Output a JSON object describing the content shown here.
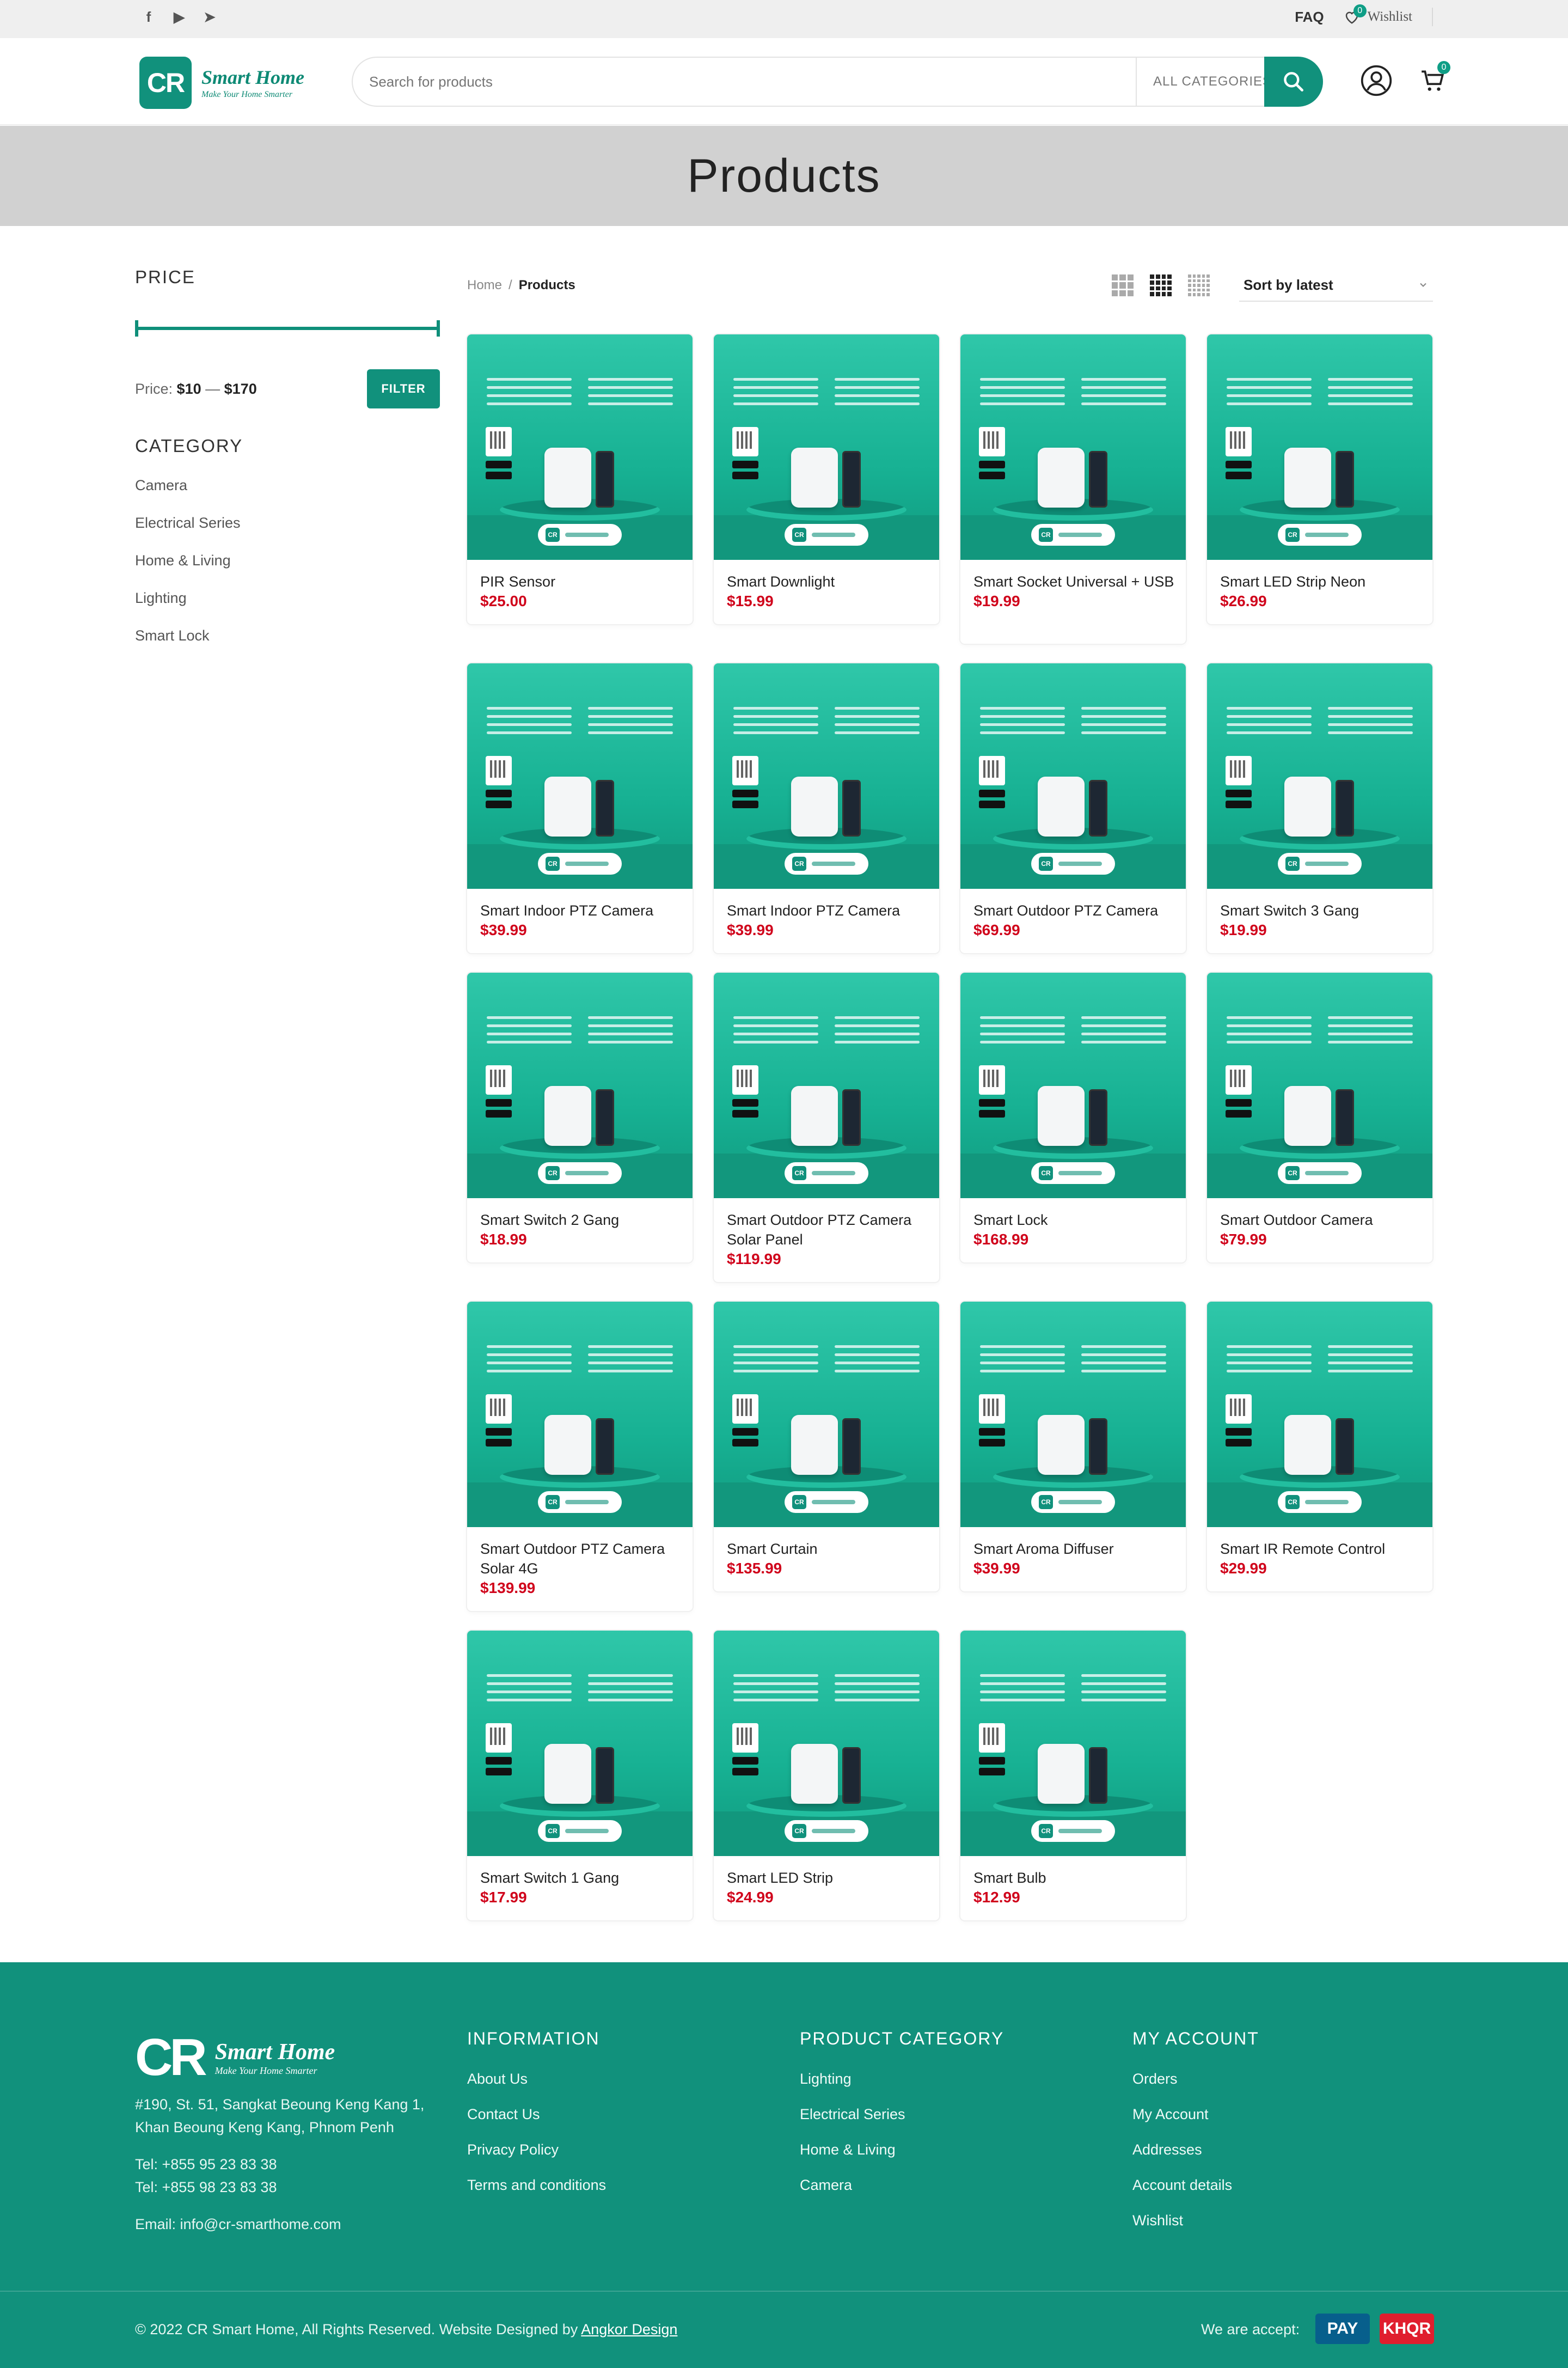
{
  "topbar": {
    "social": [
      "f",
      "▶",
      "➤"
    ],
    "faq": "FAQ",
    "wishlist": "Wishlist",
    "wishlist_count": "0"
  },
  "header": {
    "logo_mark": "CR",
    "logo_title": "Smart Home",
    "logo_tagline": "Make Your Home Smarter",
    "search_placeholder": "Search for products",
    "category_select": "ALL CATEGORIES",
    "cart_count": "0"
  },
  "page_title": "Products",
  "sidebar": {
    "price_heading": "PRICE",
    "price_label": "Price:",
    "price_min": "$10",
    "price_sep": "—",
    "price_max": "$170",
    "filter_label": "FILTER",
    "category_heading": "CATEGORY",
    "categories": [
      "Camera",
      "Electrical Series",
      "Home & Living",
      "Lighting",
      "Smart Lock"
    ]
  },
  "toolbar": {
    "breadcrumb_home": "Home",
    "breadcrumb_sep": "/",
    "breadcrumb_current": "Products",
    "sort_label": "Sort by latest"
  },
  "products": [
    {
      "name": "PIR Sensor",
      "price": "$25.00"
    },
    {
      "name": "Smart Downlight",
      "price": "$15.99"
    },
    {
      "name": "Smart Socket Universal + USB",
      "price": "$19.99"
    },
    {
      "name": "Smart LED Strip Neon",
      "price": "$26.99"
    },
    {
      "name": "Smart Indoor PTZ Camera",
      "price": "$39.99"
    },
    {
      "name": "Smart Indoor PTZ Camera",
      "price": "$39.99"
    },
    {
      "name": "Smart Outdoor PTZ Camera",
      "price": "$69.99"
    },
    {
      "name": "Smart Switch 3 Gang",
      "price": "$19.99"
    },
    {
      "name": "Smart Switch 2 Gang",
      "price": "$18.99"
    },
    {
      "name": "Smart Outdoor PTZ Camera Solar Panel",
      "price": "$119.99"
    },
    {
      "name": "Smart Lock",
      "price": "$168.99"
    },
    {
      "name": "Smart Outdoor Camera",
      "price": "$79.99"
    },
    {
      "name": "Smart Outdoor PTZ Camera Solar 4G",
      "price": "$139.99"
    },
    {
      "name": "Smart Curtain",
      "price": "$135.99"
    },
    {
      "name": "Smart Aroma Diffuser",
      "price": "$39.99"
    },
    {
      "name": "Smart IR Remote Control",
      "price": "$29.99"
    },
    {
      "name": "Smart Switch 1 Gang",
      "price": "$17.99"
    },
    {
      "name": "Smart LED Strip",
      "price": "$24.99"
    },
    {
      "name": "Smart Bulb",
      "price": "$12.99"
    }
  ],
  "footer": {
    "logo_mark": "CR",
    "logo_title": "Smart Home",
    "logo_tagline": "Make Your Home Smarter",
    "address": "#190, St. 51, Sangkat Beoung Keng Kang 1, Khan Beoung Keng Kang, Phnom Penh",
    "tel1": "Tel: +855 95 23 83 38",
    "tel2": "Tel: +855 98 23 83 38",
    "email": "Email: info@cr-smarthome.com",
    "info_heading": "INFORMATION",
    "info_links": [
      "About Us",
      "Contact Us",
      "Privacy Policy",
      "Terms and conditions"
    ],
    "cat_heading": "PRODUCT CATEGORY",
    "cat_links": [
      "Lighting",
      "Electrical Series",
      "Home & Living",
      "Camera"
    ],
    "acct_heading": "MY ACCOUNT",
    "acct_links": [
      "Orders",
      "My Account",
      "Addresses",
      "Account details",
      "Wishlist"
    ],
    "copyright": "© 2022 CR Smart Home, All Rights Reserved. Website Designed by",
    "designer": "Angkor Design",
    "accept": "We are accept:",
    "pay1": "PAY",
    "pay2": "KHQR"
  },
  "colors": {
    "brand": "#11917c",
    "price": "#d0021b"
  }
}
